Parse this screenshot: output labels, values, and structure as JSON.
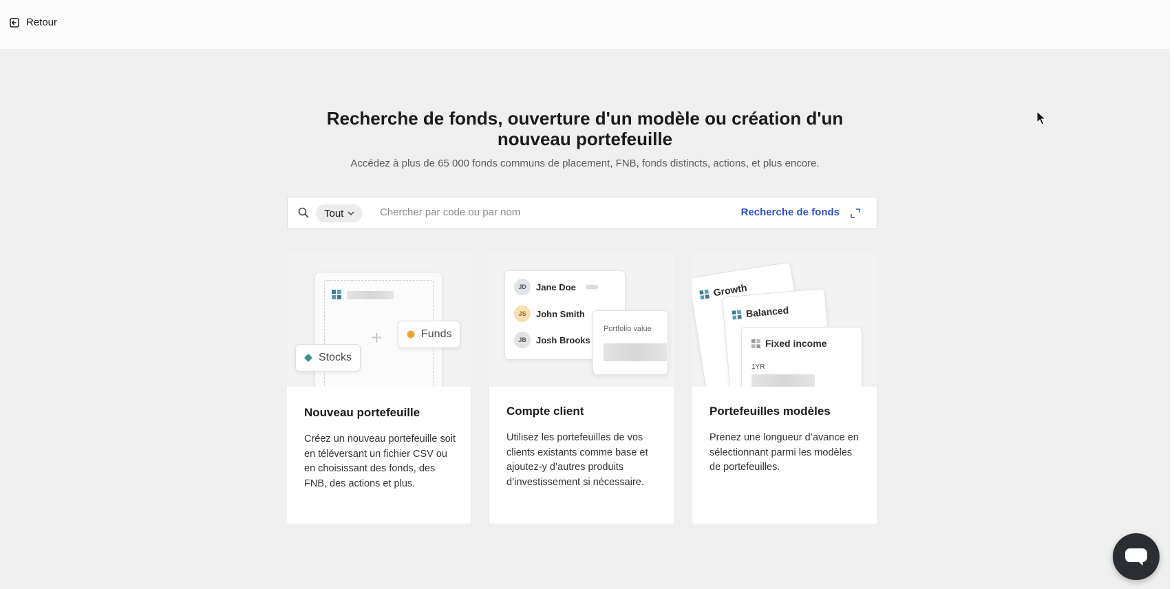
{
  "topbar": {
    "back_label": "Retour"
  },
  "hero": {
    "title_line1": "Recherche de fonds, ouverture d'un modèle ou création d'un",
    "title_line2": "nouveau portefeuille",
    "subtitle": "Accédez à plus de 65 000 fonds communs de placement, FNB, fonds distincts, actions, et plus encore."
  },
  "search": {
    "scope_value": "Tout",
    "placeholder": "Chercher par code ou par nom",
    "fund_search_link": "Recherche de fonds"
  },
  "cards": [
    {
      "title": "Nouveau portefeuille",
      "description": "Créez un nouveau portefeuille soit en téléversant un fichier CSV ou en choisissant des fonds, des FNB, des actions et plus.",
      "illustration": {
        "stocks_label": "Stocks",
        "funds_label": "Funds"
      }
    },
    {
      "title": "Compte client",
      "description": "Utilisez les portefeuilles de vos clients existants comme base et ajoutez-y d’autres produits d’investissement si nécessaire.",
      "illustration": {
        "clients": [
          {
            "initials": "JD",
            "name": "Jane Doe"
          },
          {
            "initials": "JS",
            "name": "John Smith"
          },
          {
            "initials": "JB",
            "name": "Josh Brooks"
          }
        ],
        "portfolio_value_label": "Portfolio value"
      }
    },
    {
      "title": "Portefeuilles modèles",
      "description": "Prenez une longueur d’avance en sélectionnant parmi les modèles de portefeuilles.",
      "illustration": {
        "models": [
          "Growth",
          "Balanced",
          "Fixed income"
        ],
        "period_label": "1YR"
      }
    }
  ],
  "colors": {
    "accent_link": "#2f55c4",
    "background": "#efefef",
    "chat_button": "#2a2d33"
  }
}
